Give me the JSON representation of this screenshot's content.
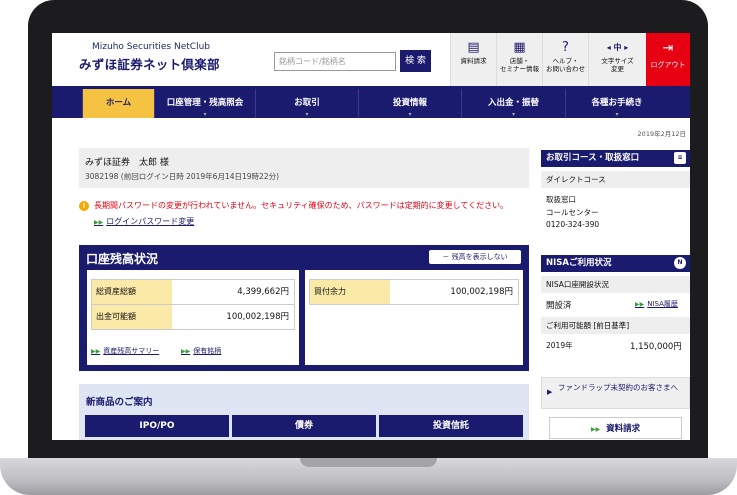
{
  "header": {
    "logo_top": "Mizuho Securities NetClub",
    "logo_main": "みずほ証券ネット倶楽部",
    "search_placeholder": "銘柄コード/銘柄名",
    "search_button": "検 索",
    "buttons": [
      {
        "label": "資料請求",
        "icon": "document-icon"
      },
      {
        "label": "店舗・\nセミナー情報",
        "icon": "building-icon"
      },
      {
        "label": "ヘルプ・\nお問い合わせ",
        "icon": "help-icon"
      },
      {
        "label": "文字サイズ\n変更",
        "icon": "font-size-icon",
        "glyph": "◂ 中 ▸"
      }
    ],
    "logout": "ログアウト"
  },
  "nav": [
    "ホーム",
    "口座管理・残高照会",
    "お取引",
    "投資情報",
    "入出金・振替",
    "各種お手続き"
  ],
  "date": "2019年2月12日",
  "user": {
    "name": "みずほ証券　太郎 様",
    "last_login": "3082198 (前回ログイン日時 2019年6月14日19時22分)"
  },
  "warning": "長期間パスワードの変更が行われていません。セキュリティ確保のため、パスワードは定期的に変更してください。",
  "password_link": "ログインパスワード変更",
  "balance": {
    "title": "口座残高状況",
    "show_button": "－ 残高を表示しない",
    "total_label": "総資産総額",
    "total_value": "4,399,662円",
    "withdraw_label": "出金可能額",
    "withdraw_value": "100,002,198円",
    "buying_label": "買付余力",
    "buying_value": "100,002,198円",
    "summary_link": "資産残高サマリー",
    "holdings_link": "保有銘柄"
  },
  "new_products": {
    "title": "新商品のご案内",
    "buttons": [
      "IPO/PO",
      "債券",
      "投資信託"
    ]
  },
  "right": {
    "course_title": "お取引コース・取扱窓口",
    "course": "ダイレクトコース",
    "window_label": "取扱窓口",
    "window_name": "コールセンター",
    "window_phone": "0120-324-390",
    "nisa_title": "NISAご利用状況",
    "nisa_status_label": "NISA口座開設状況",
    "nisa_status": "開設済",
    "nisa_history_link": "NISA履歴",
    "nisa_limit_label": "ご利用可能額 [前日基準]",
    "nisa_year": "2019年",
    "nisa_amount": "1,150,000円",
    "fundwrap": "ファンドラップ未契約のお客さまへ",
    "doc_request": "資料請求"
  }
}
